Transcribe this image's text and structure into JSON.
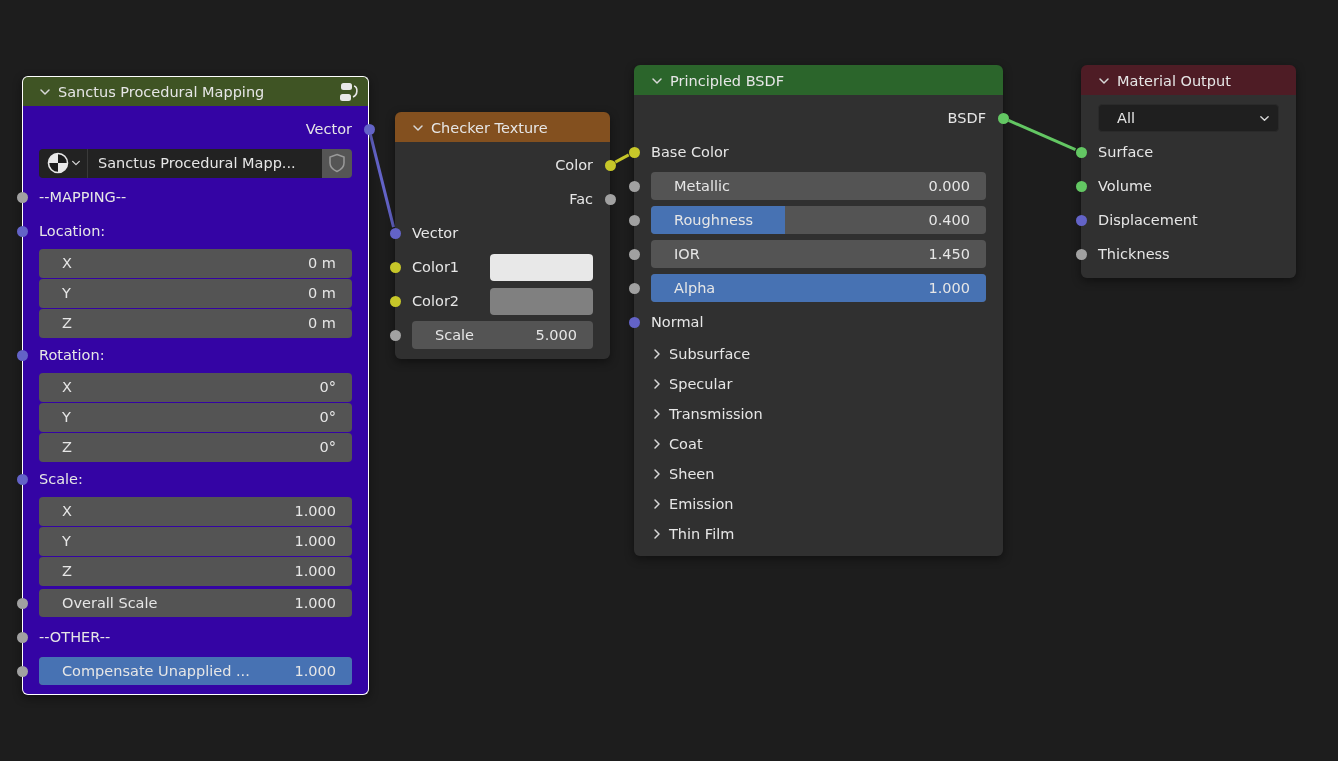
{
  "nodes": [
    {
      "title": "Sanctus Procedural Mapping",
      "color": "#3f5424",
      "body": {
        "color": "#3404a4"
      },
      "selected": true,
      "rows": [
        {
          "kind": "output",
          "label": "Vector",
          "socket": {
            "color": "#6363c7"
          }
        },
        {
          "kind": "datablock",
          "label": "Sanctus Procedural Mapp..."
        },
        {
          "kind": "label",
          "label": "--MAPPING--",
          "socket": {
            "color": "#a1a1a1"
          }
        },
        {
          "kind": "label",
          "label": "Location:",
          "socket": {
            "color": "#6363c7"
          }
        },
        {
          "kind": "component",
          "label": "X",
          "value": "0 m"
        },
        {
          "kind": "component",
          "label": "Y",
          "value": "0 m"
        },
        {
          "kind": "component",
          "label": "Z",
          "value": "0 m"
        },
        {
          "kind": "label",
          "label": "Rotation:",
          "socket": {
            "color": "#6363c7"
          }
        },
        {
          "kind": "component",
          "label": "X",
          "value": "0°"
        },
        {
          "kind": "component",
          "label": "Y",
          "value": "0°"
        },
        {
          "kind": "component",
          "label": "Z",
          "value": "0°"
        },
        {
          "kind": "label",
          "label": "Scale:",
          "socket": {
            "color": "#6363c7"
          }
        },
        {
          "kind": "component",
          "label": "X",
          "value": "1.000"
        },
        {
          "kind": "component",
          "label": "Y",
          "value": "1.000"
        },
        {
          "kind": "component",
          "label": "Z",
          "value": "1.000"
        },
        {
          "kind": "field",
          "label": "Overall Scale",
          "value": "1.000",
          "socket": {
            "color": "#a1a1a1"
          }
        },
        {
          "kind": "label",
          "label": "--OTHER--",
          "socket": {
            "color": "#a1a1a1"
          }
        },
        {
          "kind": "field",
          "label": "Compensate Unapplied ...",
          "value": "1.000",
          "level": 1,
          "socket": {
            "color": "#a1a1a1"
          }
        }
      ]
    },
    {
      "title": "Checker Texture",
      "color": "#83501f",
      "body": {
        "color": "#303030"
      },
      "selected": false,
      "rows": [
        {
          "kind": "output",
          "label": "Color",
          "socket": {
            "color": "#c7c729"
          }
        },
        {
          "kind": "output",
          "label": "Fac",
          "socket": {
            "color": "#a1a1a1"
          }
        },
        {
          "kind": "input",
          "label": "Vector",
          "socket": {
            "color": "#6363c7"
          }
        },
        {
          "kind": "color",
          "label": "Color1",
          "color": "#e8e8e8",
          "socket": {
            "color": "#c7c729"
          }
        },
        {
          "kind": "color",
          "label": "Color2",
          "color": "#808080",
          "socket": {
            "color": "#c7c729"
          }
        },
        {
          "kind": "field",
          "label": "Scale",
          "value": "5.000",
          "socket": {
            "color": "#a1a1a1"
          }
        }
      ]
    },
    {
      "title": "Principled BSDF",
      "color": "#2b652b",
      "body": {
        "color": "#303030"
      },
      "selected": false,
      "rows": [
        {
          "kind": "output",
          "label": "BSDF",
          "socket": {
            "color": "#63c763"
          }
        },
        {
          "kind": "input",
          "label": "Base Color",
          "socket": {
            "color": "#c7c729"
          }
        },
        {
          "kind": "field",
          "label": "Metallic",
          "value": "0.000",
          "socket": {
            "color": "#a1a1a1"
          }
        },
        {
          "kind": "field",
          "label": "Roughness",
          "value": "0.400",
          "level": 0.4,
          "socket": {
            "color": "#a1a1a1"
          }
        },
        {
          "kind": "field",
          "label": "IOR",
          "value": "1.450",
          "socket": {
            "color": "#a1a1a1"
          }
        },
        {
          "kind": "field",
          "label": "Alpha",
          "value": "1.000",
          "level": 1,
          "socket": {
            "color": "#a1a1a1"
          }
        },
        {
          "kind": "input",
          "label": "Normal",
          "socket": {
            "color": "#6363c7"
          }
        },
        {
          "kind": "panel",
          "label": "Subsurface",
          "expanded": false
        },
        {
          "kind": "panel",
          "label": "Specular",
          "expanded": false
        },
        {
          "kind": "panel",
          "label": "Transmission",
          "expanded": false
        },
        {
          "kind": "panel",
          "label": "Coat",
          "expanded": false
        },
        {
          "kind": "panel",
          "label": "Sheen",
          "expanded": false
        },
        {
          "kind": "panel",
          "label": "Emission",
          "expanded": false
        },
        {
          "kind": "panel",
          "label": "Thin Film",
          "expanded": false
        }
      ]
    },
    {
      "title": "Material Output",
      "color": "#4e1c25",
      "body": {
        "color": "#303030"
      },
      "selected": false,
      "rows": [
        {
          "kind": "dropdown",
          "label": "All"
        },
        {
          "kind": "input",
          "label": "Surface",
          "socket": {
            "color": "#63c763"
          }
        },
        {
          "kind": "input",
          "label": "Volume",
          "socket": {
            "color": "#63c763"
          }
        },
        {
          "kind": "input",
          "label": "Displacement",
          "socket": {
            "color": "#6363c7"
          }
        },
        {
          "kind": "input",
          "label": "Thickness",
          "socket": {
            "color": "#a1a1a1"
          }
        }
      ]
    }
  ]
}
